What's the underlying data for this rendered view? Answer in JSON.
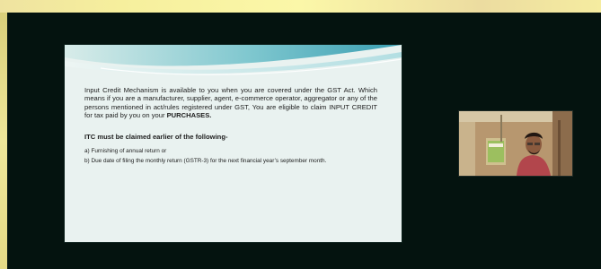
{
  "slide": {
    "intro_a": "Input Credit Mechanism is available to you when you are covered under the GST Act. Which means if you are a manufacturer, supplier, agent, e-commerce operator, aggregator or any of the persons mentioned in act/rules registered under GST, You are eligible to claim INPUT CREDIT for tax paid by you on your ",
    "intro_bold": "PURCHASES.",
    "itc_heading": "ITC must be claimed earlier of the following-",
    "itc_items": [
      "a) Furnishing of annual return or",
      "b) Due date of filing the monthly return (GSTR-3) for the next financial year’s september month."
    ]
  },
  "colors": {
    "stage_bg": "#04130f",
    "slide_bg": "#e9f2f0",
    "wave_accent": "#5fb8c4",
    "outer_frame": "#f1ea9c"
  },
  "webcam": {
    "icon": "presenter-video-thumbnail"
  }
}
